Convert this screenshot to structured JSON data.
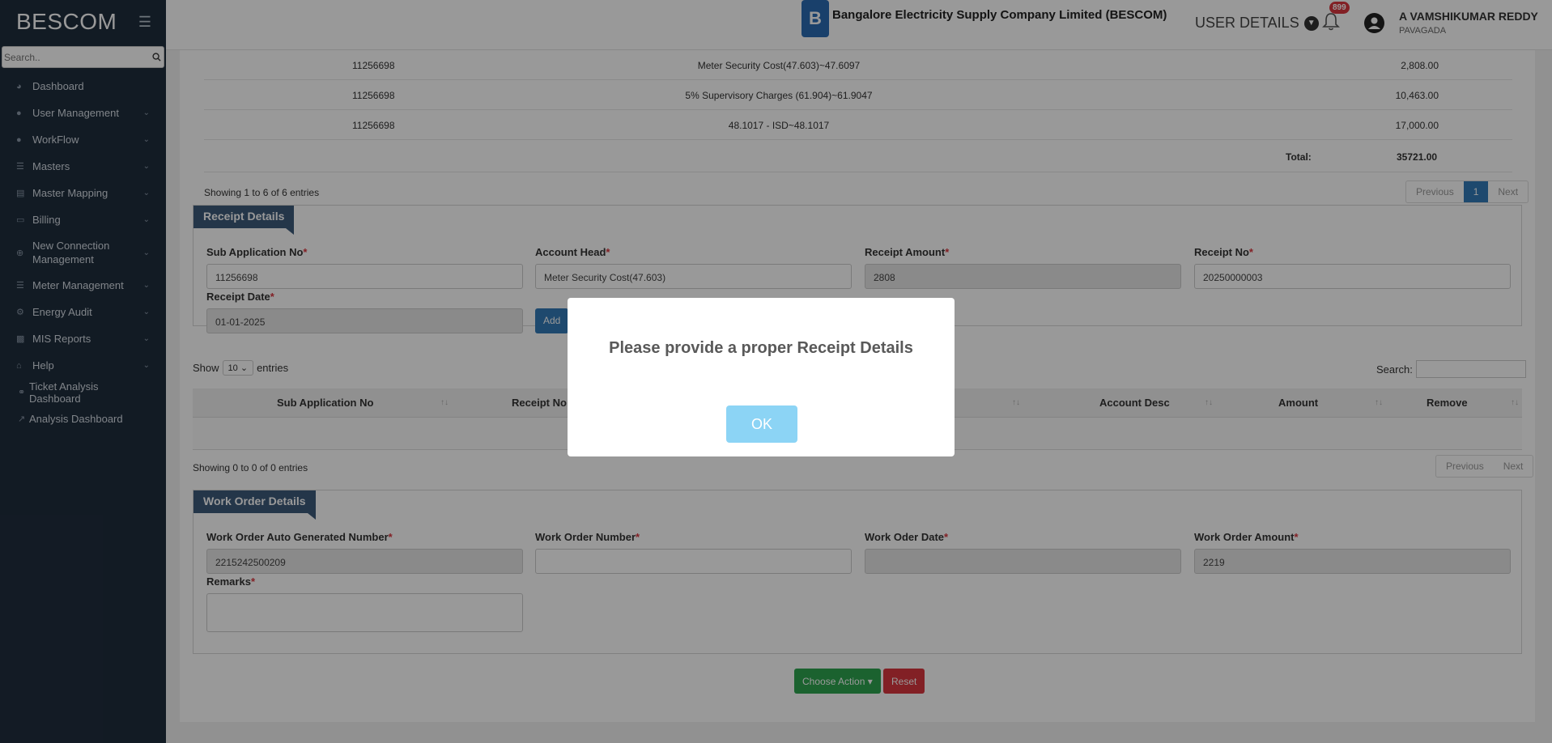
{
  "sidebar": {
    "brand": "BESCOM",
    "search_placeholder": "Search..",
    "items": [
      {
        "label": "Dashboard"
      },
      {
        "label": "User Management"
      },
      {
        "label": "WorkFlow"
      },
      {
        "label": "Masters"
      },
      {
        "label": "Master Mapping"
      },
      {
        "label": "Billing"
      },
      {
        "label": "New Connection Management"
      },
      {
        "label": "Meter Management"
      },
      {
        "label": "Energy Audit"
      },
      {
        "label": "MIS Reports"
      },
      {
        "label": "Help"
      },
      {
        "label": "Ticket Analysis Dashboard"
      },
      {
        "label": "Analysis Dashboard"
      }
    ]
  },
  "header": {
    "company_name": "Bangalore Electricity Supply Company Limited (BESCOM)",
    "user_details_label": "USER DETAILS",
    "notification_count": "899",
    "user_name": "A VAMSHIKUMAR REDDY",
    "user_location": "PAVAGADA"
  },
  "amounts_table": {
    "rows": [
      {
        "sub_app": "11256698",
        "desc": "Meter Security Cost(47.603)~47.6097",
        "amount": "2,808.00"
      },
      {
        "sub_app": "11256698",
        "desc": "5% Supervisory Charges (61.904)~61.9047",
        "amount": "10,463.00"
      },
      {
        "sub_app": "11256698",
        "desc": "48.1017 - ISD~48.1017",
        "amount": "17,000.00"
      }
    ],
    "total_label": "Total:",
    "total_value": "35721.00",
    "showing": "Showing 1 to 6 of 6 entries",
    "pager": {
      "previous": "Previous",
      "page": "1",
      "next": "Next"
    }
  },
  "receipt": {
    "title": "Receipt Details",
    "sub_app_label": "Sub Application No",
    "sub_app_value": "11256698",
    "account_head_label": "Account Head",
    "account_head_value": "Meter Security Cost(47.603)",
    "receipt_amount_label": "Receipt Amount",
    "receipt_amount_value": "2808",
    "receipt_no_label": "Receipt No",
    "receipt_no_value": "20250000003",
    "receipt_date_label": "Receipt Date",
    "receipt_date_value": "01-01-2025",
    "add_label": "Add",
    "req": "*"
  },
  "receipt_table": {
    "show_label": "Show",
    "entries_value": "10",
    "entries_label": "entries",
    "search_label": "Search:",
    "columns": [
      "Sub Application No",
      "Receipt No",
      "Account Desc",
      "Amount",
      "Remove"
    ],
    "showing": "Showing 0 to 0 of 0 entries",
    "pager": {
      "previous": "Previous",
      "next": "Next"
    }
  },
  "work_order": {
    "title": "Work Order Details",
    "auto_no_label": "Work Order Auto Generated Number",
    "auto_no_value": "2215242500209",
    "number_label": "Work Order Number",
    "date_label": "Work Oder Date",
    "amount_label": "Work Order Amount",
    "amount_value": "2219",
    "remarks_label": "Remarks"
  },
  "actions": {
    "choose_action": "Choose Action",
    "reset": "Reset"
  },
  "modal": {
    "message": "Please provide a proper Receipt Details",
    "ok": "OK"
  }
}
